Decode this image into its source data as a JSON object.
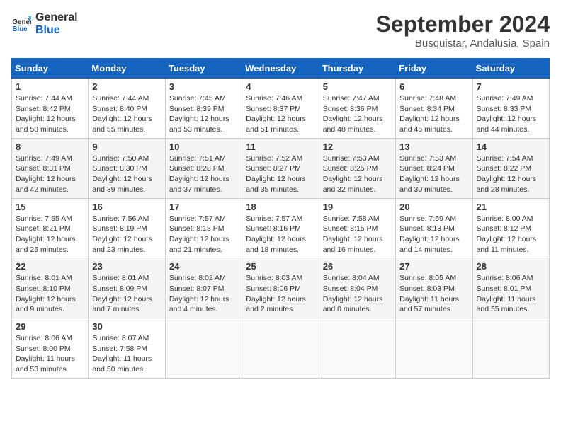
{
  "header": {
    "logo_line1": "General",
    "logo_line2": "Blue",
    "month": "September 2024",
    "location": "Busquistar, Andalusia, Spain"
  },
  "weekdays": [
    "Sunday",
    "Monday",
    "Tuesday",
    "Wednesday",
    "Thursday",
    "Friday",
    "Saturday"
  ],
  "weeks": [
    [
      {
        "day": "1",
        "info": "Sunrise: 7:44 AM\nSunset: 8:42 PM\nDaylight: 12 hours\nand 58 minutes."
      },
      {
        "day": "2",
        "info": "Sunrise: 7:44 AM\nSunset: 8:40 PM\nDaylight: 12 hours\nand 55 minutes."
      },
      {
        "day": "3",
        "info": "Sunrise: 7:45 AM\nSunset: 8:39 PM\nDaylight: 12 hours\nand 53 minutes."
      },
      {
        "day": "4",
        "info": "Sunrise: 7:46 AM\nSunset: 8:37 PM\nDaylight: 12 hours\nand 51 minutes."
      },
      {
        "day": "5",
        "info": "Sunrise: 7:47 AM\nSunset: 8:36 PM\nDaylight: 12 hours\nand 48 minutes."
      },
      {
        "day": "6",
        "info": "Sunrise: 7:48 AM\nSunset: 8:34 PM\nDaylight: 12 hours\nand 46 minutes."
      },
      {
        "day": "7",
        "info": "Sunrise: 7:49 AM\nSunset: 8:33 PM\nDaylight: 12 hours\nand 44 minutes."
      }
    ],
    [
      {
        "day": "8",
        "info": "Sunrise: 7:49 AM\nSunset: 8:31 PM\nDaylight: 12 hours\nand 42 minutes."
      },
      {
        "day": "9",
        "info": "Sunrise: 7:50 AM\nSunset: 8:30 PM\nDaylight: 12 hours\nand 39 minutes."
      },
      {
        "day": "10",
        "info": "Sunrise: 7:51 AM\nSunset: 8:28 PM\nDaylight: 12 hours\nand 37 minutes."
      },
      {
        "day": "11",
        "info": "Sunrise: 7:52 AM\nSunset: 8:27 PM\nDaylight: 12 hours\nand 35 minutes."
      },
      {
        "day": "12",
        "info": "Sunrise: 7:53 AM\nSunset: 8:25 PM\nDaylight: 12 hours\nand 32 minutes."
      },
      {
        "day": "13",
        "info": "Sunrise: 7:53 AM\nSunset: 8:24 PM\nDaylight: 12 hours\nand 30 minutes."
      },
      {
        "day": "14",
        "info": "Sunrise: 7:54 AM\nSunset: 8:22 PM\nDaylight: 12 hours\nand 28 minutes."
      }
    ],
    [
      {
        "day": "15",
        "info": "Sunrise: 7:55 AM\nSunset: 8:21 PM\nDaylight: 12 hours\nand 25 minutes."
      },
      {
        "day": "16",
        "info": "Sunrise: 7:56 AM\nSunset: 8:19 PM\nDaylight: 12 hours\nand 23 minutes."
      },
      {
        "day": "17",
        "info": "Sunrise: 7:57 AM\nSunset: 8:18 PM\nDaylight: 12 hours\nand 21 minutes."
      },
      {
        "day": "18",
        "info": "Sunrise: 7:57 AM\nSunset: 8:16 PM\nDaylight: 12 hours\nand 18 minutes."
      },
      {
        "day": "19",
        "info": "Sunrise: 7:58 AM\nSunset: 8:15 PM\nDaylight: 12 hours\nand 16 minutes."
      },
      {
        "day": "20",
        "info": "Sunrise: 7:59 AM\nSunset: 8:13 PM\nDaylight: 12 hours\nand 14 minutes."
      },
      {
        "day": "21",
        "info": "Sunrise: 8:00 AM\nSunset: 8:12 PM\nDaylight: 12 hours\nand 11 minutes."
      }
    ],
    [
      {
        "day": "22",
        "info": "Sunrise: 8:01 AM\nSunset: 8:10 PM\nDaylight: 12 hours\nand 9 minutes."
      },
      {
        "day": "23",
        "info": "Sunrise: 8:01 AM\nSunset: 8:09 PM\nDaylight: 12 hours\nand 7 minutes."
      },
      {
        "day": "24",
        "info": "Sunrise: 8:02 AM\nSunset: 8:07 PM\nDaylight: 12 hours\nand 4 minutes."
      },
      {
        "day": "25",
        "info": "Sunrise: 8:03 AM\nSunset: 8:06 PM\nDaylight: 12 hours\nand 2 minutes."
      },
      {
        "day": "26",
        "info": "Sunrise: 8:04 AM\nSunset: 8:04 PM\nDaylight: 12 hours\nand 0 minutes."
      },
      {
        "day": "27",
        "info": "Sunrise: 8:05 AM\nSunset: 8:03 PM\nDaylight: 11 hours\nand 57 minutes."
      },
      {
        "day": "28",
        "info": "Sunrise: 8:06 AM\nSunset: 8:01 PM\nDaylight: 11 hours\nand 55 minutes."
      }
    ],
    [
      {
        "day": "29",
        "info": "Sunrise: 8:06 AM\nSunset: 8:00 PM\nDaylight: 11 hours\nand 53 minutes."
      },
      {
        "day": "30",
        "info": "Sunrise: 8:07 AM\nSunset: 7:58 PM\nDaylight: 11 hours\nand 50 minutes."
      },
      null,
      null,
      null,
      null,
      null
    ]
  ]
}
